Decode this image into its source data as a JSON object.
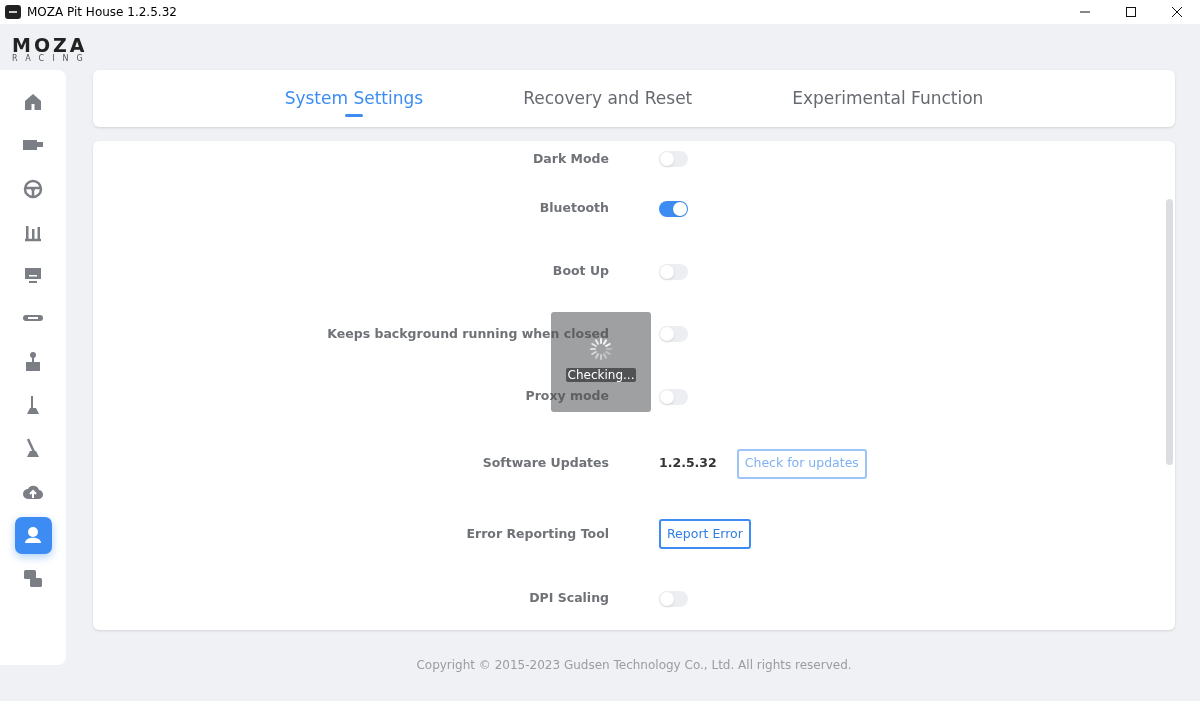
{
  "window": {
    "title": "MOZA Pit House 1.2.5.32"
  },
  "logo": {
    "name": "MOZA",
    "subtitle": "RACING"
  },
  "sidebar": {
    "items": [
      {
        "selected": false
      },
      {
        "selected": false
      },
      {
        "selected": false
      },
      {
        "selected": false
      },
      {
        "selected": false
      },
      {
        "selected": false
      },
      {
        "selected": false
      },
      {
        "selected": false
      },
      {
        "selected": false
      },
      {
        "selected": false
      },
      {
        "selected": true
      },
      {
        "selected": false
      }
    ]
  },
  "tabs": [
    {
      "label": "System Settings",
      "selected": true
    },
    {
      "label": "Recovery and Reset",
      "selected": false
    },
    {
      "label": "Experimental Function",
      "selected": false
    }
  ],
  "settings": [
    {
      "kind": "toggle",
      "label": "Dark Mode",
      "on": false
    },
    {
      "kind": "toggle",
      "label": "Bluetooth",
      "on": true
    },
    {
      "kind": "toggle",
      "label": "Boot Up",
      "on": false
    },
    {
      "kind": "toggle",
      "label": "Keeps background running when closed",
      "on": false
    },
    {
      "kind": "toggle",
      "label": "Proxy mode",
      "on": false
    },
    {
      "kind": "version",
      "label": "Software Updates",
      "value": "1.2.5.32",
      "button": "Check for updates",
      "disabled": true
    },
    {
      "kind": "button",
      "label": "Error Reporting Tool",
      "button": "Report Error",
      "disabled": false
    },
    {
      "kind": "toggle",
      "label": "DPI Scaling",
      "on": false
    }
  ],
  "loading": {
    "text": "Checking..."
  },
  "footer": "Copyright © 2015-2023 Gudsen Technology Co., Ltd. All rights reserved."
}
